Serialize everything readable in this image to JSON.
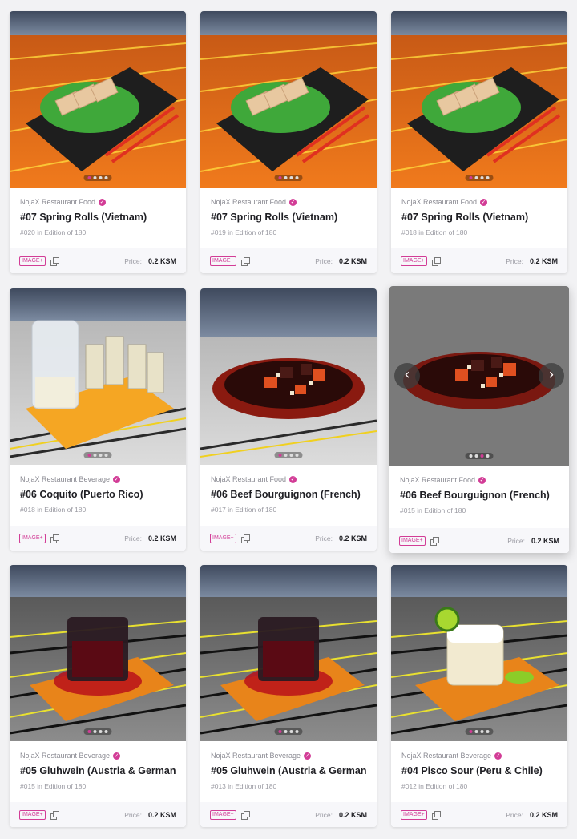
{
  "cards": [
    {
      "collection": "NojaX Restaurant Food",
      "title": "#07 Spring Rolls (Vietnam)",
      "edition": "#020 in Edition of 180",
      "badge": "IMAGE+",
      "price_label": "Price:",
      "price": "0.2 KSM",
      "scene": "rolls"
    },
    {
      "collection": "NojaX Restaurant Food",
      "title": "#07 Spring Rolls (Vietnam)",
      "edition": "#019 in Edition of 180",
      "badge": "IMAGE+",
      "price_label": "Price:",
      "price": "0.2 KSM",
      "scene": "rolls"
    },
    {
      "collection": "NojaX Restaurant Food",
      "title": "#07 Spring Rolls (Vietnam)",
      "edition": "#018 in Edition of 180",
      "badge": "IMAGE+",
      "price_label": "Price:",
      "price": "0.2 KSM",
      "scene": "rolls"
    },
    {
      "collection": "NojaX Restaurant Beverage",
      "title": "#06 Coquito (Puerto Rico)",
      "edition": "#018 in Edition of 180",
      "badge": "IMAGE+",
      "price_label": "Price:",
      "price": "0.2 KSM",
      "scene": "coquito"
    },
    {
      "collection": "NojaX Restaurant Food",
      "title": "#06 Beef Bourguignon (French)",
      "edition": "#017 in Edition of 180",
      "badge": "IMAGE+",
      "price_label": "Price:",
      "price": "0.2 KSM",
      "scene": "beef"
    },
    {
      "collection": "NojaX Restaurant Food",
      "title": "#06 Beef Bourguignon (French)",
      "edition": "#015 in Edition of 180",
      "badge": "IMAGE+",
      "price_label": "Price:",
      "price": "0.2 KSM",
      "scene": "beef-grey"
    },
    {
      "collection": "NojaX Restaurant Beverage",
      "title": "#05 Gluhwein (Austria & Germany)",
      "edition": "#015 in Edition of 180",
      "badge": "IMAGE+",
      "price_label": "Price:",
      "price": "0.2 KSM",
      "scene": "gluhwein"
    },
    {
      "collection": "NojaX Restaurant Beverage",
      "title": "#05 Gluhwein (Austria & Germany)",
      "edition": "#013 in Edition of 180",
      "badge": "IMAGE+",
      "price_label": "Price:",
      "price": "0.2 KSM",
      "scene": "gluhwein"
    },
    {
      "collection": "NojaX Restaurant Beverage",
      "title": "#04 Pisco Sour (Peru & Chile)",
      "edition": "#012 in Edition of 180",
      "badge": "IMAGE+",
      "price_label": "Price:",
      "price": "0.2 KSM",
      "scene": "pisco"
    }
  ],
  "colors": {
    "accent": "#d23c96",
    "text": "#1f1f24",
    "muted": "#9b9ba3"
  },
  "icons": {
    "verified": "verified-check-icon",
    "copy": "copy-icon",
    "prev": "chevron-left-icon",
    "next": "chevron-right-icon"
  }
}
